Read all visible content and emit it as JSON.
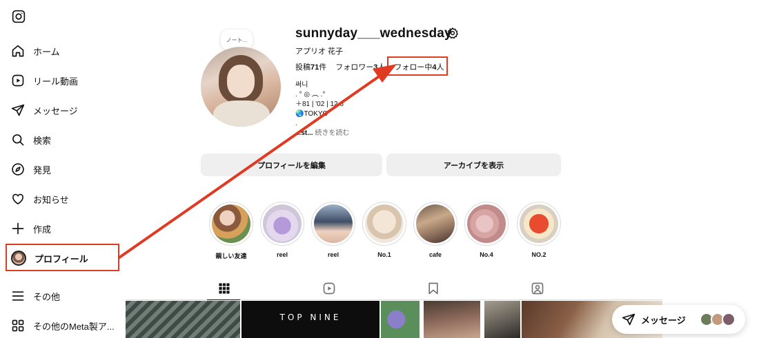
{
  "sidebar": {
    "logo": "instagram-icon",
    "items": [
      {
        "label": "ホーム",
        "icon": "home-icon"
      },
      {
        "label": "リール動画",
        "icon": "reels-icon"
      },
      {
        "label": "メッセージ",
        "icon": "send-icon"
      },
      {
        "label": "検索",
        "icon": "search-icon"
      },
      {
        "label": "発見",
        "icon": "compass-icon"
      },
      {
        "label": "お知らせ",
        "icon": "heart-icon"
      },
      {
        "label": "作成",
        "icon": "plus-icon"
      },
      {
        "label": "プロフィール",
        "icon": "avatar"
      },
      {
        "label": "その他",
        "icon": "menu-icon"
      },
      {
        "label": "その他のMeta製ア...",
        "icon": "apps-icon"
      }
    ]
  },
  "profile": {
    "note": "ノート...",
    "username": "sunnyday___wednesday",
    "full_name": "アプリオ 花子",
    "posts_label": "投稿",
    "posts_count": "71",
    "posts_unit": "件",
    "followers_label": "フォロワー",
    "followers_count": "3",
    "followers_unit": "人",
    "following_label": "フォロー中",
    "following_count": "4",
    "following_unit": "人",
    "bio_lines": [
      "써니",
      ". ° ◎ ︵ .°",
      "＋81 | '02 | 12.6",
      "🌏TOKYO",
      "."
    ],
    "bio_last_prefix": "...st...",
    "bio_more": "続きを読む"
  },
  "buttons": {
    "edit_profile": "プロフィールを編集",
    "view_archive": "アーカイブを表示"
  },
  "highlights": [
    {
      "label": "親しい友達"
    },
    {
      "label": "reel"
    },
    {
      "label": "reel"
    },
    {
      "label": "No.1"
    },
    {
      "label": "cafe"
    },
    {
      "label": "No.4"
    },
    {
      "label": "NO.2"
    }
  ],
  "tabs": [
    {
      "icon": "grid-icon"
    },
    {
      "icon": "reels-icon"
    },
    {
      "icon": "bookmark-icon"
    },
    {
      "icon": "tagged-icon"
    }
  ],
  "grid": {
    "top_nine_text": "TOP NINE"
  },
  "message_bar": {
    "label": "メッセージ"
  },
  "colors": {
    "annotation": "#e03a22",
    "button_bg": "#efefef",
    "muted_text": "#737373"
  }
}
